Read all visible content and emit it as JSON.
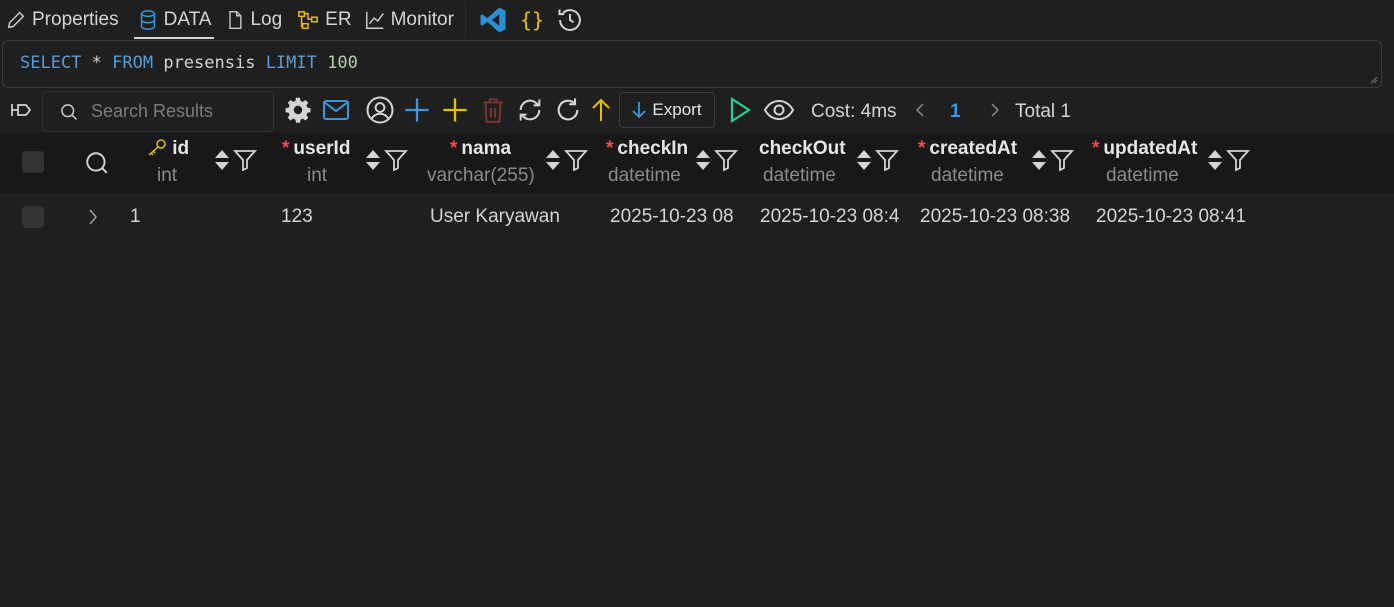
{
  "tabs": [
    {
      "label": "Properties",
      "icon": "pencil-icon"
    },
    {
      "label": "DATA",
      "icon": "database-icon",
      "active": true
    },
    {
      "label": "Log",
      "icon": "file-icon"
    },
    {
      "label": "ER",
      "icon": "er-diagram-icon"
    },
    {
      "label": "Monitor",
      "icon": "chart-line-icon"
    }
  ],
  "toolbar_icons": [
    "vscode-icon",
    "braces-icon",
    "history-icon"
  ],
  "query": {
    "select": "SELECT",
    "star": " * ",
    "from": "FROM",
    "table": " presensis ",
    "limit": "LIMIT",
    "limit_value": " 100"
  },
  "results_toolbar": {
    "search_placeholder": "Search Results",
    "export_label": "Export",
    "cost": "Cost: 4ms",
    "page": "1",
    "total": "Total 1"
  },
  "colors": {
    "background": "#1f1f1f",
    "header_bg": "#181818",
    "keyword": "#569cd6",
    "number": "#b5cea8",
    "accent_blue": "#3a96dd",
    "accent_yellow": "#e5c000",
    "accent_green": "#23d18b",
    "required": "#f14c4c",
    "delete_red": "#7a3333"
  },
  "columns": [
    {
      "name": "id",
      "type": "int",
      "primary_key": true,
      "required": false
    },
    {
      "name": "userId",
      "type": "int",
      "primary_key": false,
      "required": true
    },
    {
      "name": "nama",
      "type": "varchar(255)",
      "primary_key": false,
      "required": true
    },
    {
      "name": "checkIn",
      "type": "datetime",
      "primary_key": false,
      "required": true
    },
    {
      "name": "checkOut",
      "type": "datetime",
      "primary_key": false,
      "required": false
    },
    {
      "name": "createdAt",
      "type": "datetime",
      "primary_key": false,
      "required": true
    },
    {
      "name": "updatedAt",
      "type": "datetime",
      "primary_key": false,
      "required": true
    }
  ],
  "rows": [
    [
      "1",
      "123",
      "User Karyawan",
      "2025-10-23 08",
      "2025-10-23 08:4",
      "2025-10-23 08:38",
      "2025-10-23 08:41"
    ]
  ]
}
